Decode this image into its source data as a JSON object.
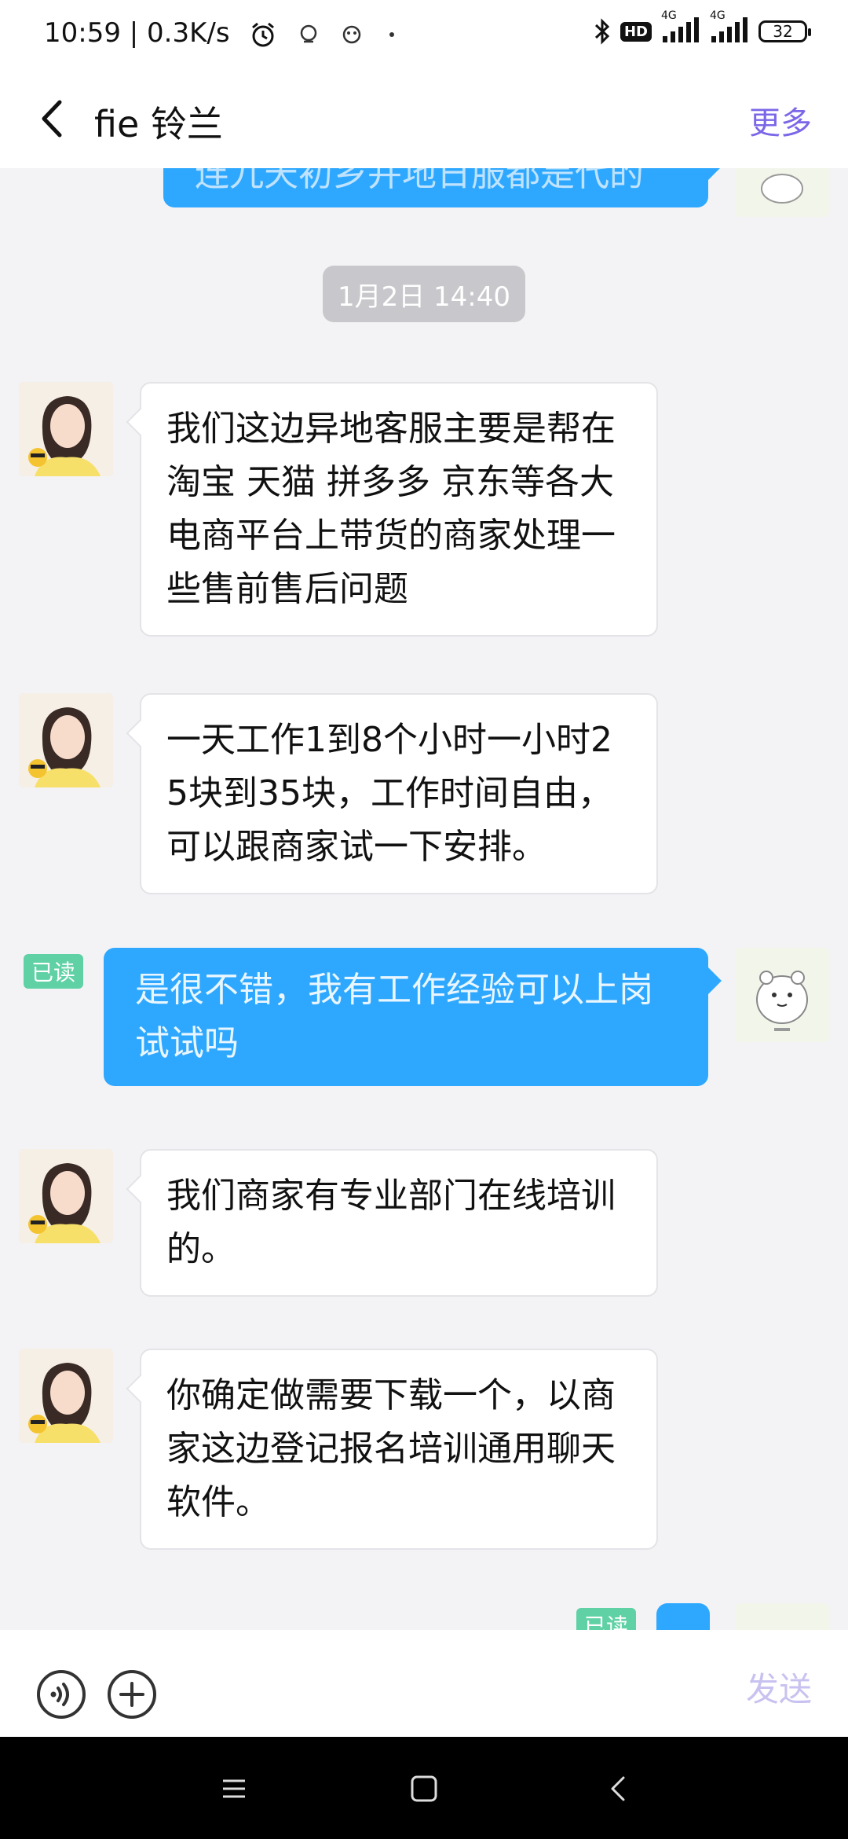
{
  "status_bar": {
    "time_speed": "10:59 | 0.3K/s",
    "hd": "HD",
    "network1": "4G",
    "network2": "4G",
    "battery": "32"
  },
  "header": {
    "title": "fie 铃兰",
    "more": "更多"
  },
  "chat": {
    "timestamp": "1月2日 14:40",
    "read_label": "已读",
    "partial_top_text": "连九天初乡并地日服都是代的",
    "messages": [
      {
        "sender": "contact",
        "text": "我们这边异地客服主要是帮在  淘宝   天猫  拼多多  京东等各大电商平台上带货的商家处理一些售前售后问题"
      },
      {
        "sender": "contact",
        "text": "一天工作1到8个小时一小时25块到35块，工作时间自由，可以跟商家试一下安排。"
      },
      {
        "sender": "me",
        "text": "是很不错，我有工作经验可以上岗试试吗",
        "status": "已读"
      },
      {
        "sender": "contact",
        "text": "我们商家有专业部门在线培训的。"
      },
      {
        "sender": "contact",
        "text": "你确定做需要下载一个，以商家这边登记报名培训通用聊天软件。"
      }
    ]
  },
  "input_bar": {
    "send": "发送"
  },
  "colors": {
    "accent": "#7a67e8",
    "outgoing_bubble": "#2ea8ff",
    "read_badge": "#5fd1a5"
  }
}
